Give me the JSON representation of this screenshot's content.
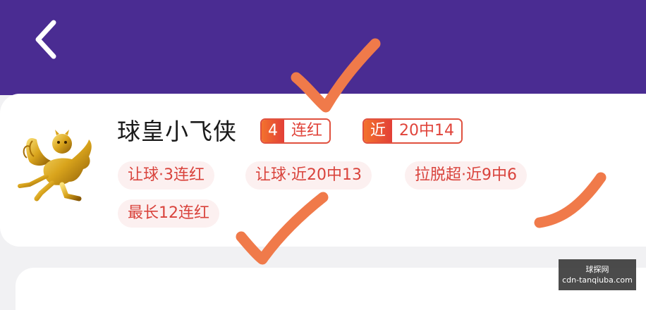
{
  "colors": {
    "header_bg": "#4a2c92",
    "accent": "#e0513f",
    "tag_bg": "#fcf0f0",
    "mark_orange": "#f07a4a"
  },
  "header": {
    "back_icon": "chevron-left-icon"
  },
  "profile": {
    "name": "球皇小飞侠",
    "avatar_icon": "golden-pegasus-avatar",
    "badges": [
      {
        "a": "4",
        "b": "连红"
      },
      {
        "a": "近",
        "b": "20中14"
      }
    ],
    "tags": [
      "让球·3连红",
      "让球·近20中13",
      "拉脱超·近9中6",
      "最长12连红"
    ]
  },
  "watermark": {
    "line1": "球探网",
    "line2": "cdn-tanqiuba.com"
  }
}
